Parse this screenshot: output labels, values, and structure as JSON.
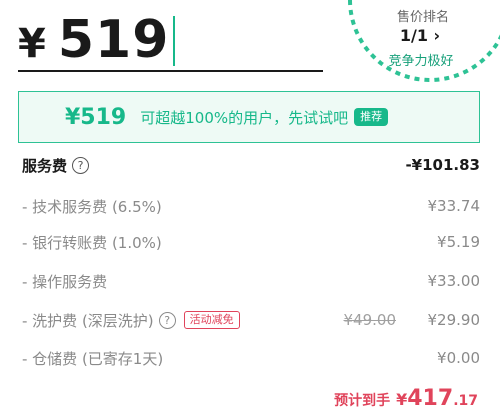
{
  "price_input": {
    "currency": "¥",
    "value": "519"
  },
  "ranking": {
    "title": "售价排名",
    "value": "1/1",
    "note": "竞争力极好",
    "accent_color": "#17b88a"
  },
  "promo": {
    "price": "¥519",
    "text": "可超越100%的用户，先试试吧",
    "tag": "推荐"
  },
  "fees": {
    "header": {
      "name": "服务费",
      "amount": "-¥101.83"
    },
    "items": [
      {
        "name": "- 技术服务费 (6.5%)",
        "amount": "¥33.74"
      },
      {
        "name": "- 银行转账费 (1.0%)",
        "amount": "¥5.19"
      },
      {
        "name": "- 操作服务费",
        "amount": "¥33.00"
      },
      {
        "name": "- 洗护费 (深层洗护)",
        "badge": "活动减免",
        "old_amount": "¥49.00",
        "amount": "¥29.90"
      },
      {
        "name": "- 仓储费 (已寄存1天)",
        "amount": "¥0.00"
      }
    ]
  },
  "total": {
    "label": "预计到手",
    "currency": "¥",
    "integer": "417",
    "decimal": ".17"
  }
}
